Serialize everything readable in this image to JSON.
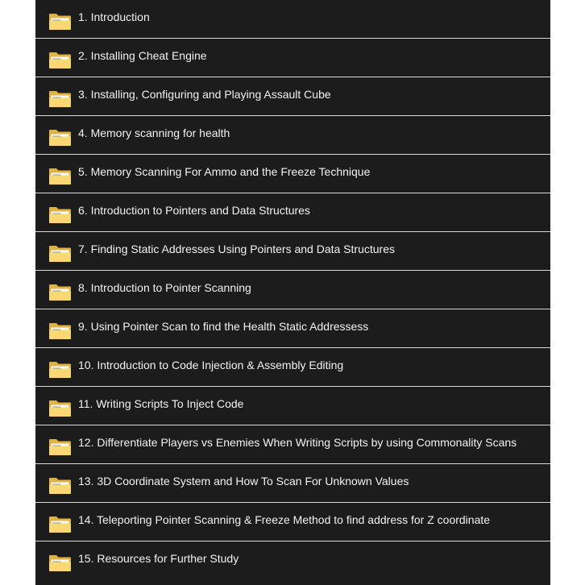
{
  "folders": [
    {
      "label": "1. Introduction",
      "icon": "folder-icon"
    },
    {
      "label": "2. Installing Cheat Engine",
      "icon": "folder-icon"
    },
    {
      "label": "3. Installing, Configuring and Playing Assault Cube",
      "icon": "folder-icon"
    },
    {
      "label": "4. Memory scanning for health",
      "icon": "folder-icon"
    },
    {
      "label": "5. Memory Scanning For Ammo and the Freeze Technique",
      "icon": "folder-icon"
    },
    {
      "label": "6. Introduction to Pointers and Data Structures",
      "icon": "folder-icon"
    },
    {
      "label": "7. Finding Static Addresses Using Pointers and Data Structures",
      "icon": "folder-icon"
    },
    {
      "label": "8. Introduction to Pointer Scanning",
      "icon": "folder-icon"
    },
    {
      "label": "9. Using Pointer Scan to find the Health Static Addressess",
      "icon": "folder-icon"
    },
    {
      "label": "10. Introduction to Code Injection & Assembly Editing",
      "icon": "folder-icon"
    },
    {
      "label": "11. Writing Scripts To Inject Code",
      "icon": "folder-icon"
    },
    {
      "label": "12. Differentiate Players vs Enemies When Writing Scripts by using Commonality Scans",
      "icon": "folder-icon"
    },
    {
      "label": "13. 3D Coordinate System and How To Scan For Unknown Values",
      "icon": "folder-icon"
    },
    {
      "label": "14. Teleporting Pointer Scanning & Freeze Method to find address for Z coordinate",
      "icon": "folder-icon"
    },
    {
      "label": "15. Resources for Further Study",
      "icon": "folder-icon"
    }
  ],
  "colors": {
    "background": "#1c1c1c",
    "text": "#f2f2f2",
    "divider": "#d9d9d9",
    "folder_back": "#e3b341",
    "folder_front": "#f8d775",
    "page_background": "#ffffff"
  }
}
